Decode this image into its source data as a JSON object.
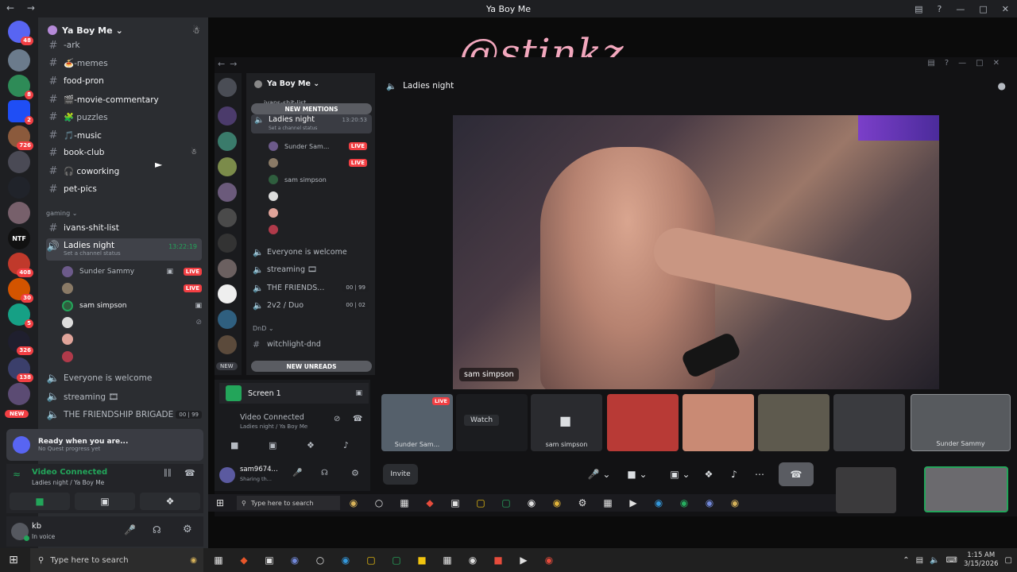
{
  "window": {
    "title": "Ya Boy Me",
    "overlay_text": "@stinkz"
  },
  "guild": {
    "name": "Ya Boy Me"
  },
  "channels": [
    {
      "label": "-ark"
    },
    {
      "label": "🍝-memes"
    },
    {
      "label": "food-pron"
    },
    {
      "label": "🎬-movie-commentary"
    },
    {
      "label": "🧩 puzzles"
    },
    {
      "label": "🎵-music"
    },
    {
      "label": "book-club"
    },
    {
      "label": "🎧 coworking"
    },
    {
      "label": "pet-pics"
    }
  ],
  "category_gaming": "gaming",
  "gaming_channels": [
    {
      "label": "ivans-shit-list"
    }
  ],
  "voice": {
    "label": "Ladies night",
    "timer": "13:22:19",
    "status_hint": "Set a channel status",
    "users": [
      {
        "name": "Sunder Sammy",
        "live": "LIVE"
      },
      {
        "name": "",
        "live": "LIVE"
      },
      {
        "name": "sam simpson",
        "live": ""
      },
      {
        "name": "",
        "live": ""
      },
      {
        "name": "",
        "live": ""
      },
      {
        "name": "",
        "live": ""
      }
    ]
  },
  "more_voice": [
    {
      "label": "Everyone is welcome",
      "count": ""
    },
    {
      "label": "streaming 🎞",
      "count": ""
    },
    {
      "label": "THE FRIENDSHIP BRIGADE",
      "count": "00 | 99"
    }
  ],
  "new_badge": "NEW",
  "quest": {
    "title": "Ready when you are...",
    "sub": "No Quest progress yet"
  },
  "vc": {
    "status": "Video Connected",
    "sub": "Ladies night / Ya Boy Me"
  },
  "user": {
    "name": "kb",
    "status": "In voice"
  },
  "inner": {
    "guild": "Ya Boy Me",
    "top_channel": "ivans-shit-list",
    "new_mentions": "NEW MENTIONS",
    "voice_label": "Ladies night",
    "voice_timer": "13:20:53",
    "voice_status": "Set a channel status",
    "users": [
      {
        "name": "Sunder Sam...",
        "live": "LIVE"
      },
      {
        "name": "",
        "live": "LIVE"
      },
      {
        "name": "sam simpson",
        "live": ""
      },
      {
        "name": "",
        "live": ""
      },
      {
        "name": "",
        "live": ""
      },
      {
        "name": "",
        "live": ""
      }
    ],
    "more": [
      {
        "label": "Everyone is welcome",
        "count": ""
      },
      {
        "label": "streaming 🎞",
        "count": ""
      },
      {
        "label": "THE FRIENDS...",
        "count": "00 | 99"
      },
      {
        "label": "2v2 / Duo",
        "count": "00 | 02"
      }
    ],
    "cat_dnd": "DnD",
    "dnd_channel": "witchlight-dnd",
    "new_unreads": "NEW UNREADS",
    "new_badge": "NEW",
    "screen": "Screen 1",
    "vc_status": "Video Connected",
    "vc_sub": "Ladies night / Ya Boy Me",
    "user_name": "sam9674...",
    "user_status": "Sharing th..."
  },
  "stage": {
    "channel": "Ladies night",
    "video_label": "sam simpson",
    "tiles": [
      {
        "name": "Sunder Sam...",
        "badge": "LIVE"
      },
      {
        "name": "",
        "badge": "Watch"
      },
      {
        "name": "sam simpson",
        "badge": ""
      },
      {
        "name": "",
        "badge": ""
      },
      {
        "name": "",
        "badge": ""
      },
      {
        "name": "",
        "badge": ""
      },
      {
        "name": "",
        "badge": ""
      },
      {
        "name": "Sunder Sammy",
        "badge": ""
      }
    ],
    "invite": "Invite"
  },
  "inner_taskbar": {
    "search": "Type here to search"
  },
  "taskbar": {
    "search": "Type here to search",
    "time": "1:15 AM",
    "date": "3/15/2026"
  },
  "server_badges": [
    "48",
    "8",
    "2",
    "726",
    "408",
    "30",
    "5",
    "326",
    "138"
  ],
  "colors": {
    "live": "#f23f43",
    "green": "#23a55a",
    "accent": "#5865f2",
    "overlay": "#f2a7bd"
  }
}
